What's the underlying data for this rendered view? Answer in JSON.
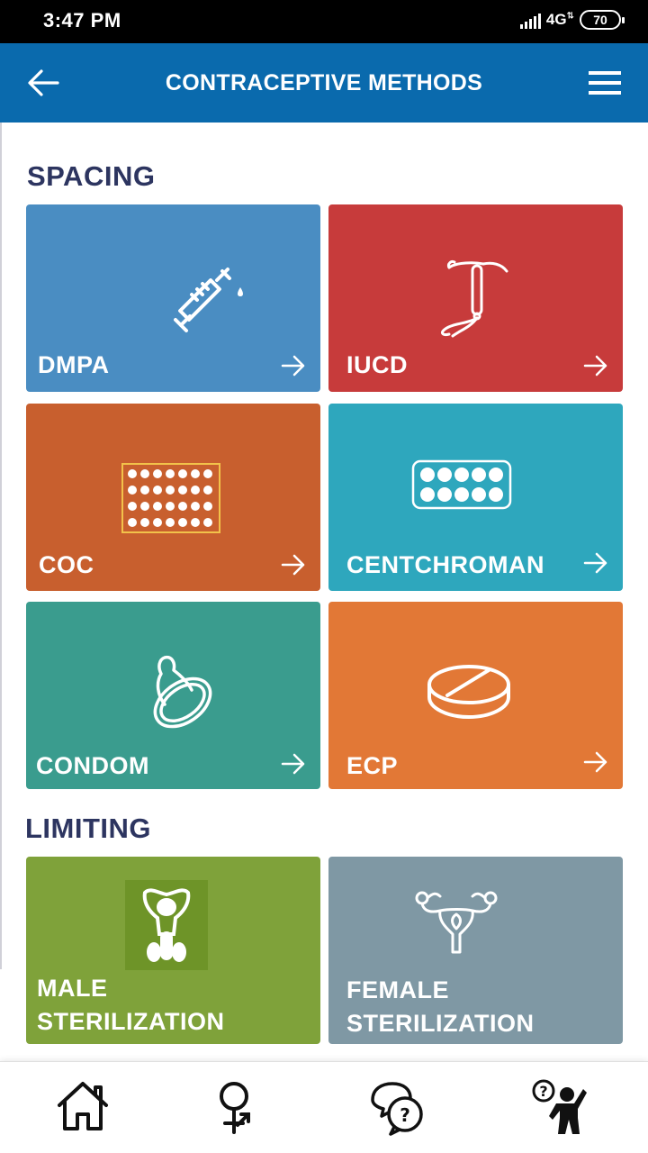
{
  "status_bar": {
    "time": "3:47 PM",
    "network": "4G",
    "battery": "70"
  },
  "app_bar": {
    "title": "CONTRACEPTIVE METHODS",
    "back_icon": "arrow-left-icon",
    "menu_icon": "hamburger-menu-icon"
  },
  "sections": {
    "spacing": "SPACING",
    "limiting": "LIMITING"
  },
  "tiles": {
    "dmpa": {
      "label": "DMPA",
      "color": "#4a8dc2",
      "icon": "syringe-icon"
    },
    "iucd": {
      "label": "IUCD",
      "color": "#c73b3b",
      "icon": "iucd-icon"
    },
    "coc": {
      "label": "COC",
      "color": "#c85f2e",
      "icon": "pill-pack-icon"
    },
    "centchroman": {
      "label": "CENTCHROMAN",
      "color": "#2ea7bd",
      "icon": "pill-strip-icon"
    },
    "condom": {
      "label": "CONDOM",
      "color": "#3a9c8e",
      "icon": "condom-icon"
    },
    "ecp": {
      "label": "ECP",
      "color": "#e27836",
      "icon": "tablet-icon"
    },
    "male_sterilization": {
      "label_line1": "MALE",
      "label_line2": "STERILIZATION",
      "color": "#7fa23a",
      "icon": "male-reproductive-icon"
    },
    "female_sterilization": {
      "label_line1": "FEMALE",
      "label_line2": "STERILIZATION",
      "color": "#7f98a4",
      "icon": "uterus-icon"
    }
  },
  "bottom_nav": {
    "items": [
      "home-icon",
      "gender-icon",
      "faq-chat-icon",
      "help-person-icon"
    ]
  }
}
